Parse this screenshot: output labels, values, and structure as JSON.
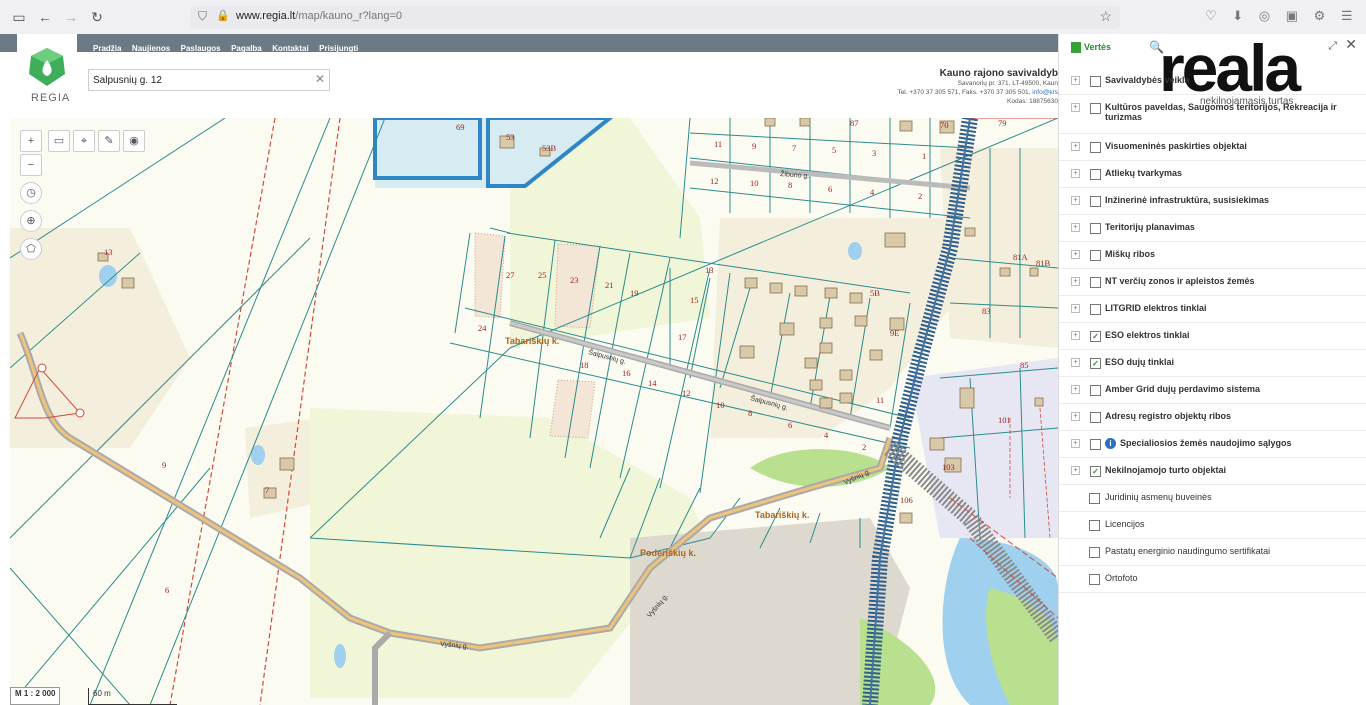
{
  "browser": {
    "url_host": "www.regia.lt",
    "url_path": "/map/kauno_r?lang=0"
  },
  "topnav": {
    "items": [
      "Pradžia",
      "Naujienos",
      "Paslaugos",
      "Pagalba",
      "Kontaktai",
      "Prisijungti"
    ]
  },
  "logo": {
    "text": "REGIA"
  },
  "search": {
    "value": "Šalpusnių g. 12"
  },
  "municipality": {
    "title": "Kauno rajono savivaldyb",
    "address": "Savanorių pr. 371, LT-49500, Kaun",
    "phone": "Tel. +370 37 305 571, Faks. +370 37 305 501,",
    "email": "info@krs",
    "code": "Kodas: 18875630"
  },
  "map": {
    "scale_label": "M 1 : 2 000",
    "scale_bar": "60 m",
    "labels": {
      "tabarisku1": "Tabariškių k.",
      "tabarisku2": "Tabariškių k.",
      "poderisku": "Poderiškių k.",
      "salpusniu1": "Šalpusnių g.",
      "salpusniu2": "Šalpusnių g.",
      "vysniu1": "Vyšnių g.",
      "vysniu2": "Vyšnių g.",
      "vysniu3": "Vyšnių g.",
      "zibunu": "Žibuno g."
    },
    "parcel_numbers": [
      "69",
      "53",
      "53B",
      "87",
      "79",
      "11",
      "9",
      "7",
      "5",
      "3",
      "1",
      "12",
      "10",
      "8",
      "6",
      "4",
      "2",
      "27",
      "25",
      "23",
      "21",
      "19",
      "13",
      "15",
      "17",
      "24",
      "18",
      "16",
      "14",
      "12",
      "10",
      "8",
      "6",
      "4",
      "2",
      "11",
      "9",
      "7",
      "6",
      "83",
      "81A",
      "81B",
      "106",
      "101",
      "103",
      "85"
    ]
  },
  "panel": {
    "tab_label": "Vertės",
    "brand": "reala",
    "brand_tagline": "nekilnojamasis turtas",
    "layers": [
      {
        "label": "Savivaldybės veikla",
        "checked": false,
        "expandable": true
      },
      {
        "label": "Kultūros paveldas, Saugomos teritorijos, Rekreacija ir turizmas",
        "checked": false,
        "expandable": true
      },
      {
        "label": "Visuomeninės paskirties objektai",
        "checked": false,
        "expandable": true
      },
      {
        "label": "Atliekų tvarkymas",
        "checked": false,
        "expandable": true
      },
      {
        "label": "Inžinerinė infrastruktūra, susisiekimas",
        "checked": false,
        "expandable": true
      },
      {
        "label": "Teritorijų planavimas",
        "checked": false,
        "expandable": true
      },
      {
        "label": "Miškų ribos",
        "checked": false,
        "expandable": true
      },
      {
        "label": "NT verčių zonos ir apleistos žemės",
        "checked": false,
        "expandable": true
      },
      {
        "label": "LITGRID elektros tinklai",
        "checked": false,
        "expandable": true
      },
      {
        "label": "ESO elektros tinklai",
        "checked": true,
        "expandable": true
      },
      {
        "label": "ESO dujų tinklai",
        "checked": true,
        "expandable": true
      },
      {
        "label": "Amber Grid dujų perdavimo sistema",
        "checked": false,
        "expandable": true
      },
      {
        "label": "Adresų registro objektų ribos",
        "checked": false,
        "expandable": true
      },
      {
        "label": "Specialiosios žemės naudojimo sąlygos",
        "checked": false,
        "expandable": true
      },
      {
        "label": "Nekilnojamojo turto objektai",
        "checked": true,
        "expandable": true
      },
      {
        "label": "Juridinių asmenų buveinės",
        "checked": false,
        "expandable": false
      },
      {
        "label": "Licencijos",
        "checked": false,
        "expandable": false
      },
      {
        "label": "Pastatų energinio naudingumo sertifikatai",
        "checked": false,
        "expandable": false
      },
      {
        "label": "Ortofoto",
        "checked": false,
        "expandable": false
      }
    ]
  }
}
